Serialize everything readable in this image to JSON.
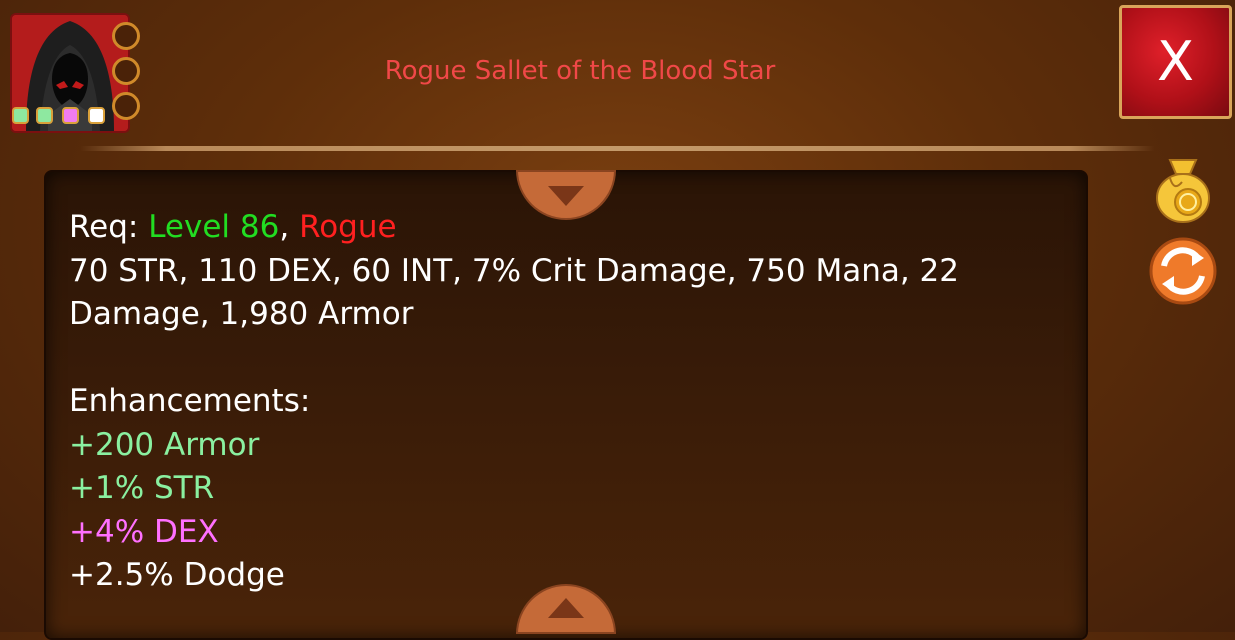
{
  "item": {
    "title": "Rogue Sallet of the Blood Star",
    "close_label": "X"
  },
  "requirements": {
    "prefix": "Req: ",
    "level": "Level 86",
    "separator": ", ",
    "class": "Rogue",
    "stats_line1": "70 STR, 110 DEX, 60 INT, 7% Crit Damage, 750 Mana, 22",
    "stats_line2": "Damage, 1,980 Armor"
  },
  "enhancements": {
    "header": "Enhancements:",
    "items": [
      "+200 Armor",
      "+1% STR",
      "+4% DEX",
      "+2.5% Dodge"
    ]
  },
  "gems": [
    "#8ee8a0",
    "#8ee8a0",
    "#f07cf0",
    "#ffffff"
  ],
  "colors": {
    "title": "#f04848",
    "level": "#22dd22",
    "class": "#ff2020",
    "enh_green": "#8af0a0",
    "enh_pink": "#ff70ff"
  },
  "icons": [
    "hooded-rogue-portrait",
    "gold-pouch-icon",
    "swap-arrows-icon",
    "chevron-down-icon",
    "chevron-up-icon"
  ]
}
